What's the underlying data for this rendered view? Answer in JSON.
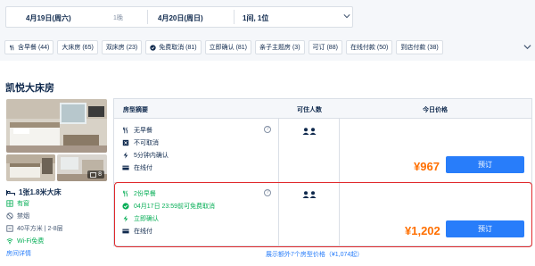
{
  "search": {
    "checkin": "4月19日(周六)",
    "nights": "1晚",
    "checkout": "4月20日(周日)",
    "rooms_guests": "1间, 1位"
  },
  "filters": [
    {
      "label": "含早餐 (44)",
      "icon": "breakfast-icon"
    },
    {
      "label": "大床房 (65)",
      "icon": ""
    },
    {
      "label": "双床房 (23)",
      "icon": ""
    },
    {
      "label": "免费取消 (81)",
      "icon": "check-circle-icon"
    },
    {
      "label": "立即确认 (81)",
      "icon": ""
    },
    {
      "label": "亲子主题房 (3)",
      "icon": ""
    },
    {
      "label": "可订 (88)",
      "icon": ""
    },
    {
      "label": "在线付款 (50)",
      "icon": ""
    },
    {
      "label": "到店付款 (38)",
      "icon": ""
    }
  ],
  "room": {
    "name": "凯悦大床房",
    "photo_count": "8",
    "bed": "1张1.8米大床",
    "window": "有窗",
    "smoking": "禁烟",
    "size_floor": "40平方米 | 2-8层",
    "wifi": "Wi-Fi免费",
    "details_link": "房间详情"
  },
  "table": {
    "col_policy": "房型摘要",
    "col_guests": "可住人数",
    "col_price": "今日价格"
  },
  "offers": [
    {
      "breakfast": "无早餐",
      "cancel": "不可取消",
      "confirm": "5分钟内确认",
      "payment": "在线付",
      "price": "¥967",
      "book": "预订"
    },
    {
      "breakfast": "2份早餐",
      "cancel": "04月17日 23:59前可免费取消",
      "confirm": "立即确认",
      "payment": "在线付",
      "price": "¥1,202",
      "book": "预订"
    }
  ],
  "more_link": "展示额外7个房型价格（¥1,074起）",
  "colors": {
    "accent": "#287dfa",
    "price": "#ff6f00",
    "green": "#06ae56",
    "highlight": "#e0292c"
  }
}
